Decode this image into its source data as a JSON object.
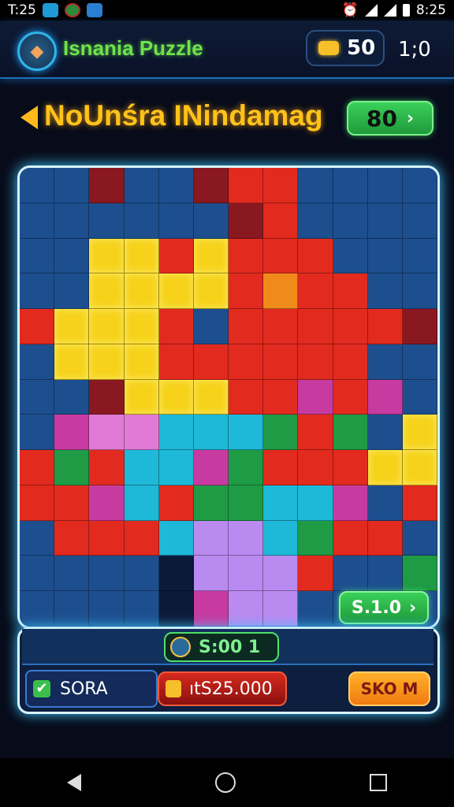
{
  "status_bar": {
    "left_time": "T:25",
    "right_time": "8:25"
  },
  "header": {
    "app_title": "Isnania Puzzle",
    "coins": "50",
    "time": "1;0"
  },
  "level": {
    "title": "NoUnśra INindamag",
    "score": "80",
    "score_arrow": "›"
  },
  "board": {
    "rows": [
      "bbdbbdrrbbbb",
      "bbbbbbdrbbbb",
      "bbyyryrrrbbb",
      "bbyyyyrorrbb",
      "ryyyrbrrrrrd",
      "byyyrrrrrrbb",
      "bbdyyyrrprpb",
      "bpkkcccgrgby",
      "rgrccpgrrryy",
      "rrpcrggccpbr",
      "brrrcllcgrrb",
      "bbbbnlllrbbg",
      "bbbbnpllbbbb"
    ],
    "button_label": "S.1.0",
    "button_arrow": "›"
  },
  "footer": {
    "timer": "S:00  1",
    "left_label": "SORA",
    "money": "ıtS25.000",
    "right_button": "SKO M"
  },
  "colors": {
    "accent_green": "#3ad05a",
    "accent_orange": "#ffb02a",
    "glow": "#40c8ff"
  }
}
